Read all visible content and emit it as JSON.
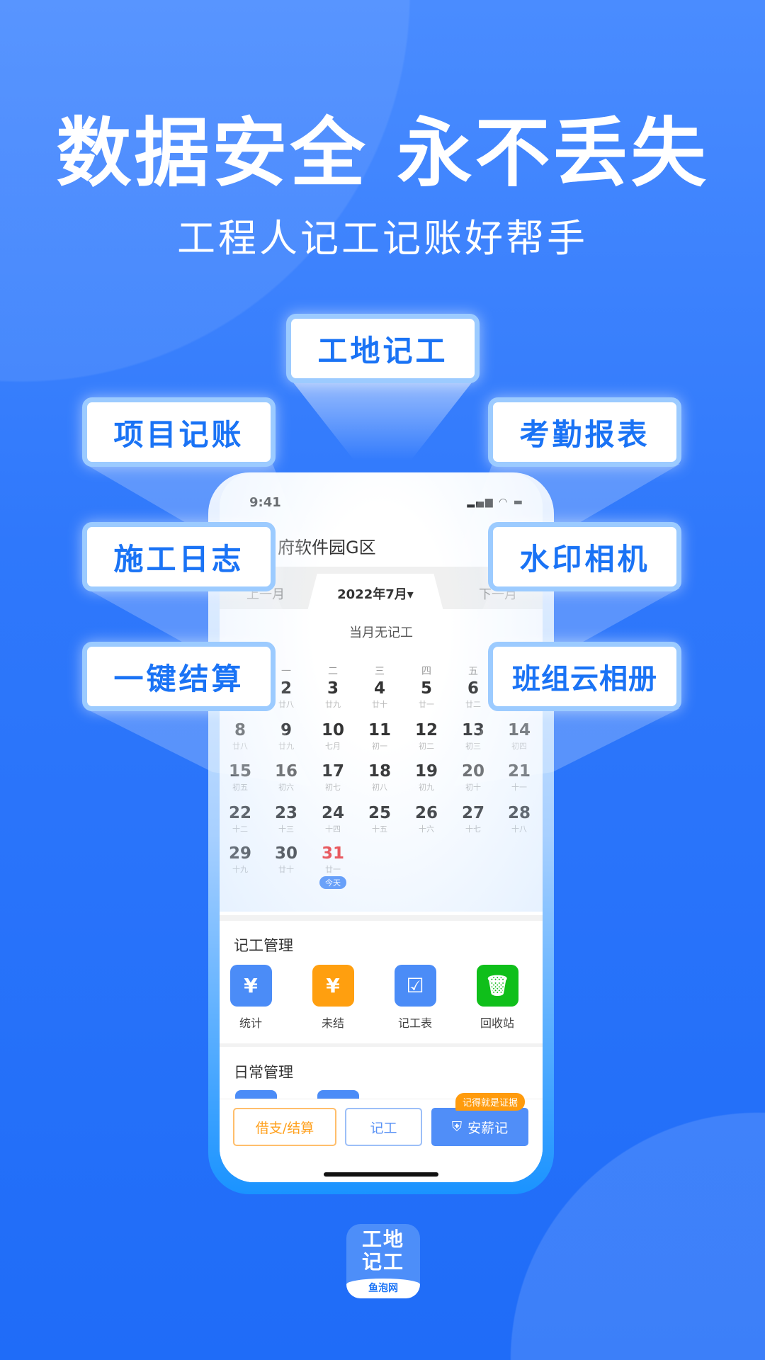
{
  "headline": "数据安全 永不丢失",
  "subheadline": "工程人记工记账好帮手",
  "feature_labels": [
    "工地记工",
    "项目记账",
    "考勤报表",
    "施工日志",
    "水印相机",
    "一键结算",
    "班组云相册"
  ],
  "phone": {
    "status_time": "9:41",
    "project_title": "府软件园G区",
    "prev_month": "上一月",
    "current_month": "2022年7月▾",
    "next_month": "下一月",
    "month_status": "当月无记工",
    "weekdays": [
      "",
      "一",
      "二",
      "三",
      "四",
      "五",
      ""
    ],
    "calendar_rows": [
      [
        null,
        {
          "d": "2",
          "l": "廿八"
        },
        {
          "d": "3",
          "l": "廿九"
        },
        {
          "d": "4",
          "l": "廿十"
        },
        {
          "d": "5",
          "l": "廿一"
        },
        {
          "d": "6",
          "l": "廿二"
        },
        null
      ],
      [
        {
          "d": "8",
          "l": "廿八"
        },
        {
          "d": "9",
          "l": "廿九"
        },
        {
          "d": "10",
          "l": "七月"
        },
        {
          "d": "11",
          "l": "初一"
        },
        {
          "d": "12",
          "l": "初二"
        },
        {
          "d": "13",
          "l": "初三"
        },
        {
          "d": "14",
          "l": "初四"
        }
      ],
      [
        {
          "d": "15",
          "l": "初五"
        },
        {
          "d": "16",
          "l": "初六"
        },
        {
          "d": "17",
          "l": "初七"
        },
        {
          "d": "18",
          "l": "初八"
        },
        {
          "d": "19",
          "l": "初九"
        },
        {
          "d": "20",
          "l": "初十"
        },
        {
          "d": "21",
          "l": "十一"
        }
      ],
      [
        {
          "d": "22",
          "l": "十二"
        },
        {
          "d": "23",
          "l": "十三"
        },
        {
          "d": "24",
          "l": "十四"
        },
        {
          "d": "25",
          "l": "十五"
        },
        {
          "d": "26",
          "l": "十六"
        },
        {
          "d": "27",
          "l": "十七"
        },
        {
          "d": "28",
          "l": "十八"
        }
      ],
      [
        {
          "d": "29",
          "l": "十九"
        },
        {
          "d": "30",
          "l": "廿十"
        },
        {
          "d": "31",
          "l": "廿一",
          "today": "今天"
        },
        null,
        null,
        null,
        null
      ]
    ],
    "today_color": "#f03a3a",
    "section1": "记工管理",
    "features": [
      {
        "label": "统计",
        "icon": "stats-icon",
        "color": "#4b8cf7",
        "glyph": "¥"
      },
      {
        "label": "未结",
        "icon": "unsettled-icon",
        "color": "#ff9f0f",
        "glyph": "¥"
      },
      {
        "label": "记工表",
        "icon": "timesheet-icon",
        "color": "#4b8cf7",
        "glyph": "☑"
      },
      {
        "label": "回收站",
        "icon": "trash-icon",
        "color": "#0fbf1a",
        "glyph": "🗑"
      }
    ],
    "section2": "日常管理",
    "btn_borrow": "借支/结算",
    "btn_record": "记工",
    "btn_salary": "安薪记",
    "badge": "记得就是证据"
  },
  "logo": {
    "line1": "工地",
    "line2": "记工",
    "brand": "鱼泡网"
  }
}
